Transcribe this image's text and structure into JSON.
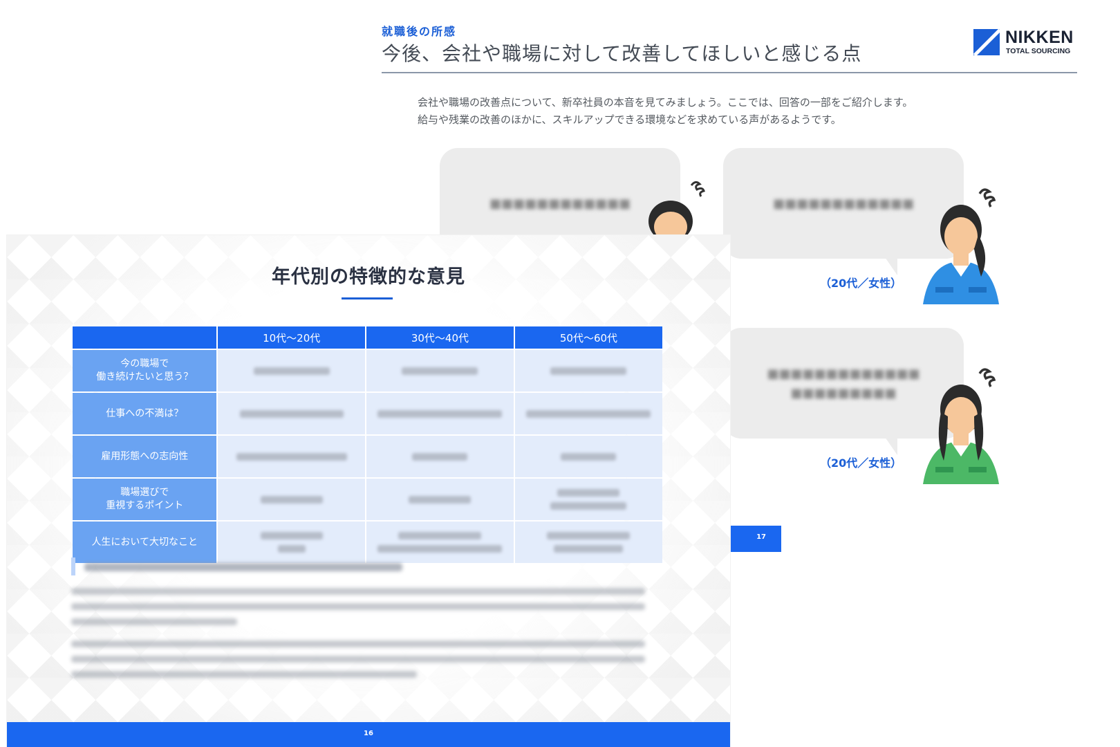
{
  "back_slide": {
    "section_label": "就職後の所感",
    "title": "今後、会社や職場に対して改善してほしいと感じる点",
    "logo": {
      "name": "NIKKEN",
      "sub": "TOTAL SOURCING"
    },
    "intro_lines": [
      "会社や職場の改善点について、新卒社員の本音を見てみましょう。ここでは、回答の一部をご紹介します。",
      "給与や残業の改善のほかに、スキルアップできる環境などを求めている声があるようです。"
    ],
    "testimonials": [
      {
        "label": ""
      },
      {
        "label": "（20代／女性）"
      },
      {
        "label": "（20代／女性）"
      }
    ],
    "page_number": "17"
  },
  "front_slide": {
    "title": "年代別の特徴的な意見",
    "table": {
      "columns": [
        "",
        "10代～20代",
        "30代～40代",
        "50代～60代"
      ],
      "row_headers": [
        "今の職場で\n働き続けたいと思う？",
        "仕事への不満は？",
        "雇用形態への志向性",
        "職場選びで\n重視するポイント",
        "人生において大切なこと"
      ]
    },
    "page_number": "16"
  },
  "colors": {
    "accent": "#1a67f0",
    "row_header": "#6aa3f2",
    "cell": "#e3ecfb",
    "person_blue": "#2f8fe3",
    "person_green": "#4cb866"
  }
}
